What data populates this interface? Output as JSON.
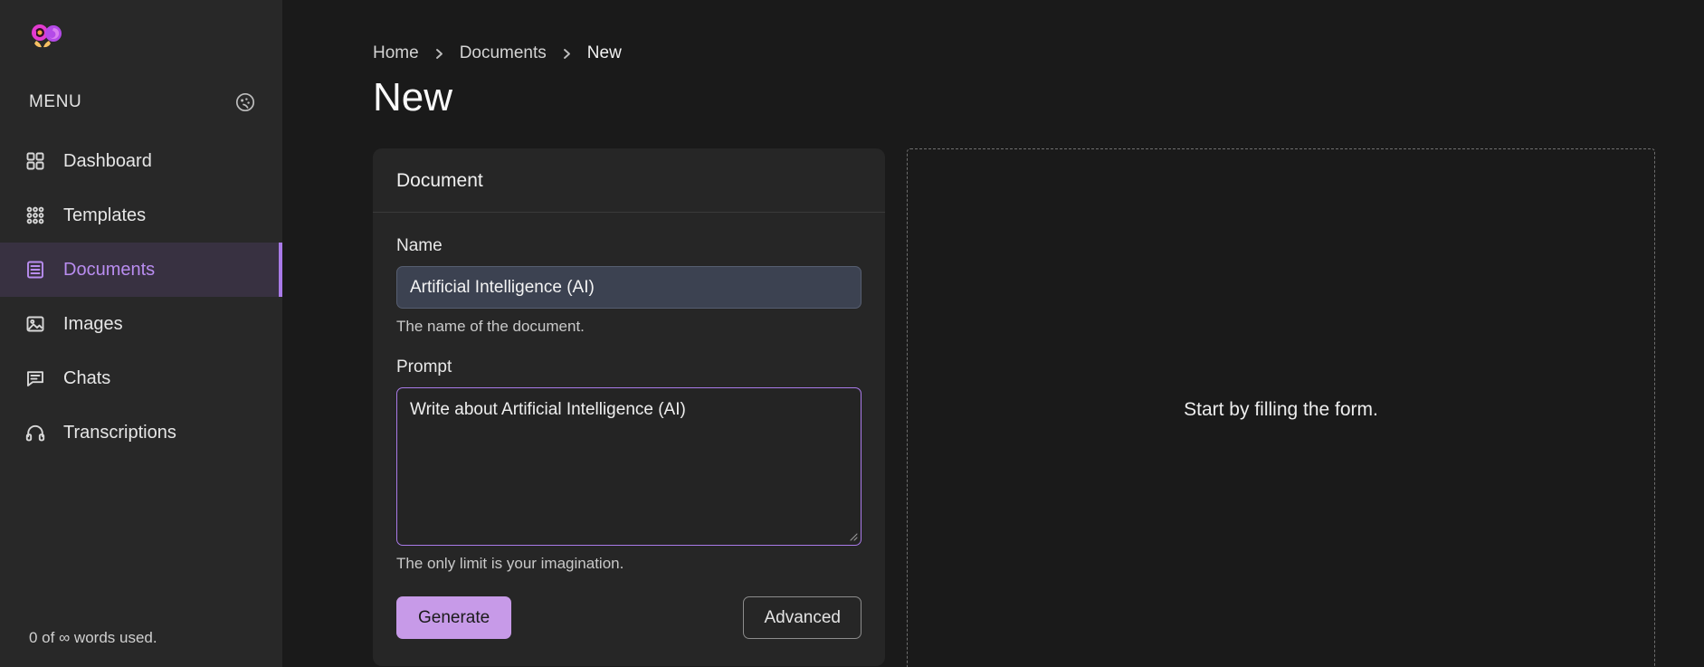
{
  "sidebar": {
    "logo_name": "app-logo",
    "menu_label": "MENU",
    "theme_icon": "palette-icon",
    "items": [
      {
        "label": "Dashboard",
        "icon": "grid-squares-icon",
        "active": false
      },
      {
        "label": "Templates",
        "icon": "dots-grid-icon",
        "active": false
      },
      {
        "label": "Documents",
        "icon": "document-lines-icon",
        "active": true
      },
      {
        "label": "Images",
        "icon": "image-icon",
        "active": false
      },
      {
        "label": "Chats",
        "icon": "chat-bubble-icon",
        "active": false
      },
      {
        "label": "Transcriptions",
        "icon": "headphones-icon",
        "active": false
      }
    ],
    "footer": {
      "words_used": "0 of ∞ words used."
    }
  },
  "header": {
    "breadcrumb": [
      {
        "label": "Home",
        "current": false
      },
      {
        "label": "Documents",
        "current": false
      },
      {
        "label": "New",
        "current": true
      }
    ],
    "breadcrumb_separator": "❯",
    "title": "New"
  },
  "form": {
    "card_title": "Document",
    "name_field": {
      "label": "Name",
      "value": "Artificial Intelligence (AI)",
      "placeholder": "Name",
      "help": "The name of the document."
    },
    "prompt_field": {
      "label": "Prompt",
      "value": "Write about Artificial Intelligence (AI)",
      "placeholder": "Prompt",
      "help": "The only limit is your imagination."
    },
    "generate_label": "Generate",
    "advanced_label": "Advanced"
  },
  "preview": {
    "empty_text": "Start by filling the form."
  },
  "colors": {
    "accent": "#a97ae8",
    "accent_button": "#c79ae8",
    "active_nav_bg": "#383141",
    "active_nav_text": "#b98df0",
    "sidebar_bg": "#282828",
    "main_bg": "#1a1a1a",
    "card_bg": "#262626",
    "input_bg": "#3c4251"
  }
}
